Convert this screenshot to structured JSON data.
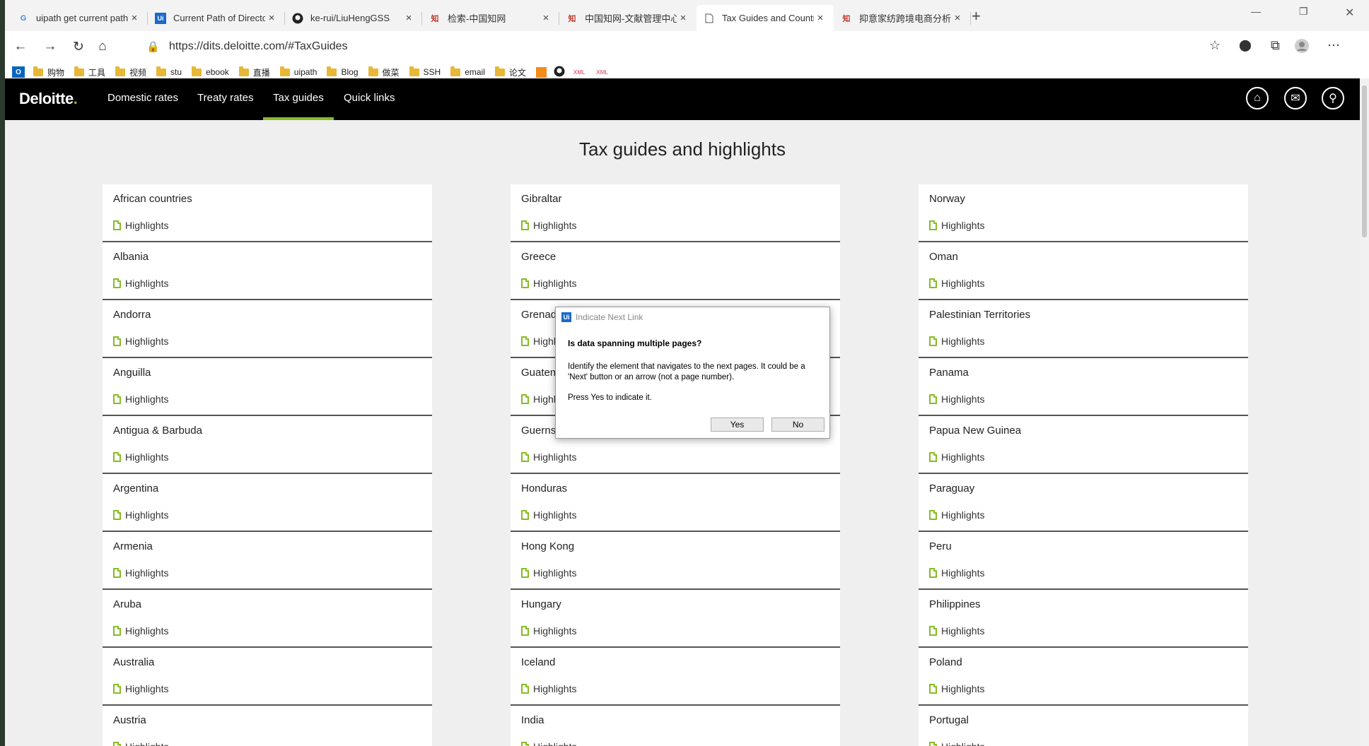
{
  "browser": {
    "tabs": [
      {
        "title": "uipath get current path - Google",
        "favicon": "G"
      },
      {
        "title": "Current Path of Directory - Build",
        "favicon": "Ui"
      },
      {
        "title": "ke-rui/LiuHengGSS",
        "favicon": "github-icon"
      },
      {
        "title": "检索-中国知网",
        "favicon": "cnki-icon"
      },
      {
        "title": "中国知网-文献管理中心",
        "favicon": "cnki-icon"
      },
      {
        "title": "Tax Guides and Country Highligh",
        "favicon": "page-icon"
      },
      {
        "title": "抑意家纺跨境电商分析与研究 - ",
        "favicon": "cnki-icon"
      }
    ],
    "url": "https://dits.deloitte.com/#TaxGuides",
    "bookmarks": [
      "购物",
      "工具",
      "视频",
      "stu",
      "ebook",
      "直播",
      "uipath",
      "Blog",
      "做菜",
      "SSH",
      "email",
      "论文"
    ]
  },
  "site": {
    "logo": "Deloitte",
    "logo_dot": ".",
    "nav": [
      "Domestic rates",
      "Treaty rates",
      "Tax guides",
      "Quick links"
    ],
    "title": "Tax guides and highlights",
    "highlight_label": "Highlights",
    "columns": [
      [
        "African countries",
        "Albania",
        "Andorra",
        "Anguilla",
        "Antigua & Barbuda",
        "Argentina",
        "Armenia",
        "Aruba",
        "Australia",
        "Austria"
      ],
      [
        "Gibraltar",
        "Greece",
        "Grenada",
        "Guatemala",
        "Guernsey",
        "Honduras",
        "Hong Kong",
        "Hungary",
        "Iceland",
        "India"
      ],
      [
        "Norway",
        "Oman",
        "Palestinian Territories",
        "Panama",
        "Papua New Guinea",
        "Paraguay",
        "Peru",
        "Philippines",
        "Poland",
        "Portugal"
      ]
    ]
  },
  "dialog": {
    "title": "Indicate Next Link",
    "question": "Is data spanning multiple pages?",
    "message": "Identify the element that navigates to the next pages. It could be a 'Next' button or an arrow (not a page number).",
    "message2": "Press Yes to indicate it.",
    "yes": "Yes",
    "no": "No"
  }
}
